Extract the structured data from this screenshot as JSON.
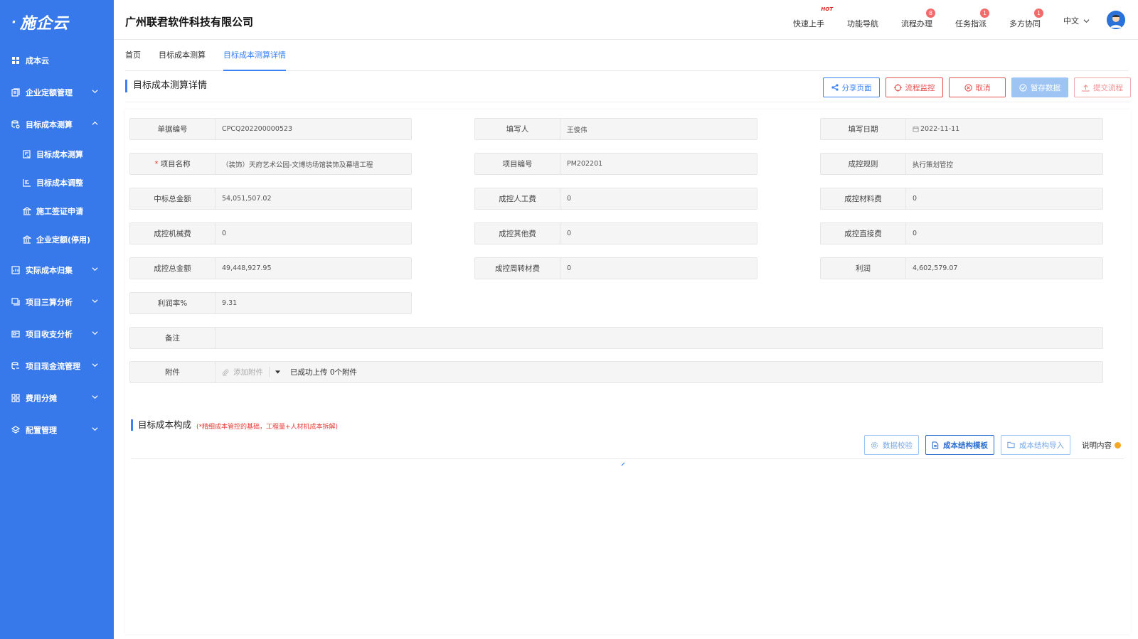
{
  "app": {
    "logo": "施企云"
  },
  "sidebar": {
    "items": [
      {
        "label": "成本云",
        "icon": "grid-icon"
      },
      {
        "label": "企业定额管理",
        "icon": "book-icon",
        "expanded": false
      },
      {
        "label": "目标成本测算",
        "icon": "database-icon",
        "expanded": true
      },
      {
        "label": "实际成本归集",
        "icon": "chart-doc-icon",
        "expanded": false
      },
      {
        "label": "项目三算分析",
        "icon": "stack-icon",
        "expanded": false
      },
      {
        "label": "项目收支分析",
        "icon": "card-icon",
        "expanded": false
      },
      {
        "label": "项目现金流管理",
        "icon": "cash-icon",
        "expanded": false
      },
      {
        "label": "费用分摊",
        "icon": "apps-icon",
        "expanded": false
      },
      {
        "label": "配置管理",
        "icon": "layers-icon",
        "expanded": false
      }
    ],
    "subitems": [
      {
        "label": "目标成本测算",
        "icon": "calc-icon"
      },
      {
        "label": "目标成本调整",
        "icon": "adjust-icon"
      },
      {
        "label": "施工签证申请",
        "icon": "bank-icon"
      },
      {
        "label": "企业定额(停用)",
        "icon": "bank-icon"
      }
    ]
  },
  "header": {
    "company": "广州联君软件科技有限公司",
    "links": [
      {
        "label": "快速上手",
        "tag": "HOT"
      },
      {
        "label": "功能导航"
      },
      {
        "label": "流程办理",
        "badge": "8"
      },
      {
        "label": "任务指派",
        "badge": "1"
      },
      {
        "label": "多方协同",
        "badge": "1"
      }
    ],
    "language": "中文"
  },
  "tabs": [
    {
      "label": "首页",
      "active": false
    },
    {
      "label": "目标成本测算",
      "active": false
    },
    {
      "label": "目标成本测算详情",
      "active": true
    }
  ],
  "page": {
    "title": "目标成本测算详情",
    "buttons": {
      "share": "分享页面",
      "monitor": "流程监控",
      "cancel": "取消",
      "save": "暂存数据",
      "submit": "提交流程"
    }
  },
  "form": {
    "doc_no": {
      "label": "单据编号",
      "value": "CPCQ202200000523"
    },
    "writer": {
      "label": "填写人",
      "value": "王俊伟"
    },
    "date": {
      "label": "填写日期",
      "value": "2022-11-11"
    },
    "project_name": {
      "label": "项目名称",
      "value": "（装饰）天府艺术公园-文博坊场馆装饰及幕墙工程",
      "required": true
    },
    "project_code": {
      "label": "项目编号",
      "value": "PM202201"
    },
    "rule": {
      "label": "成控规则",
      "value": "执行策划管控"
    },
    "bid_total": {
      "label": "中标总金额",
      "value": "54,051,507.02"
    },
    "labor": {
      "label": "成控人工费",
      "value": "0"
    },
    "material": {
      "label": "成控材料费",
      "value": "0"
    },
    "machine": {
      "label": "成控机械费",
      "value": "0"
    },
    "other": {
      "label": "成控其他费",
      "value": "0"
    },
    "direct": {
      "label": "成控直接费",
      "value": "0"
    },
    "cost_total": {
      "label": "成控总金额",
      "value": "49,448,927.95"
    },
    "turnover": {
      "label": "成控周转材费",
      "value": "0"
    },
    "profit": {
      "label": "利润",
      "value": "4,602,579.07"
    },
    "profit_rate": {
      "label": "利润率%",
      "value": "9.31"
    },
    "remark": {
      "label": "备注",
      "value": ""
    },
    "attachment": {
      "label": "附件",
      "add": "添加附件",
      "status": "已成功上传 0个附件"
    }
  },
  "section": {
    "title": "目标成本构成",
    "note": "(*精细成本管控的基础，工程量+人材机成本拆解)",
    "buttons": {
      "validate": "数据校验",
      "template": "成本结构模板",
      "import": "成本结构导入",
      "explain": "说明内容"
    }
  },
  "colors": {
    "sidebar": "#3779ea",
    "accent": "#3b82f6",
    "danger": "#e55353"
  }
}
